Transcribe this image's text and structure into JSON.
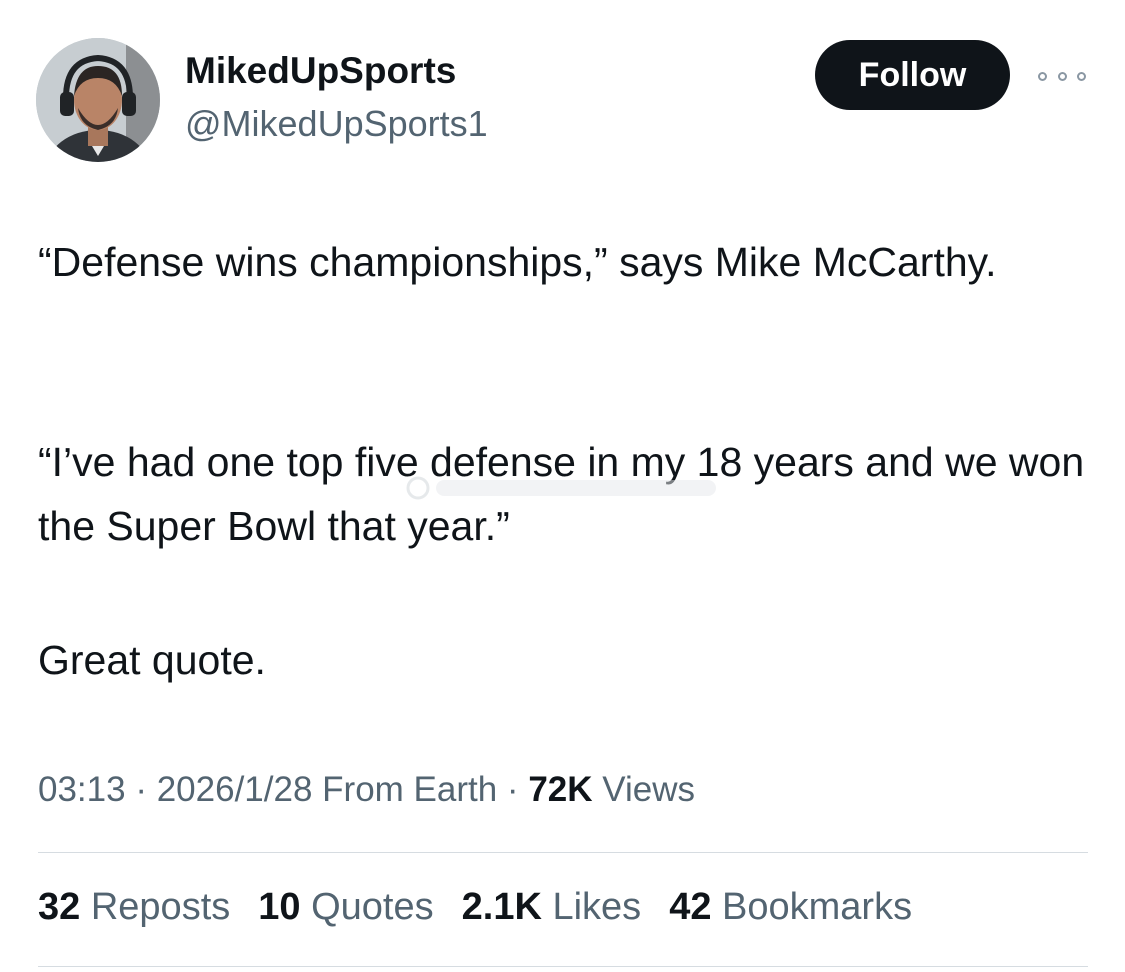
{
  "author": {
    "display_name": "MikedUpSports",
    "handle": "@MikedUpSports1"
  },
  "actions": {
    "follow_label": "Follow"
  },
  "tweet": {
    "paragraphs": [
      "“Defense wins championships,” says Mike McCarthy.",
      "“I’ve had one top five defense in my 18 years and we won the Super Bowl that year.”",
      "Great quote."
    ]
  },
  "meta": {
    "time": "03:13",
    "separator": " · ",
    "date": "2026/1/28",
    "source": "From Earth",
    "views_count": "72K",
    "views_label": "Views"
  },
  "stats": [
    {
      "count": "32",
      "label": "Reposts"
    },
    {
      "count": "10",
      "label": "Quotes"
    },
    {
      "count": "2.1K",
      "label": "Likes"
    },
    {
      "count": "42",
      "label": "Bookmarks"
    }
  ],
  "colors": {
    "text_primary": "#0f1419",
    "text_secondary": "#536471",
    "button_bg": "#0f1419",
    "divider": "#d6dce1"
  }
}
